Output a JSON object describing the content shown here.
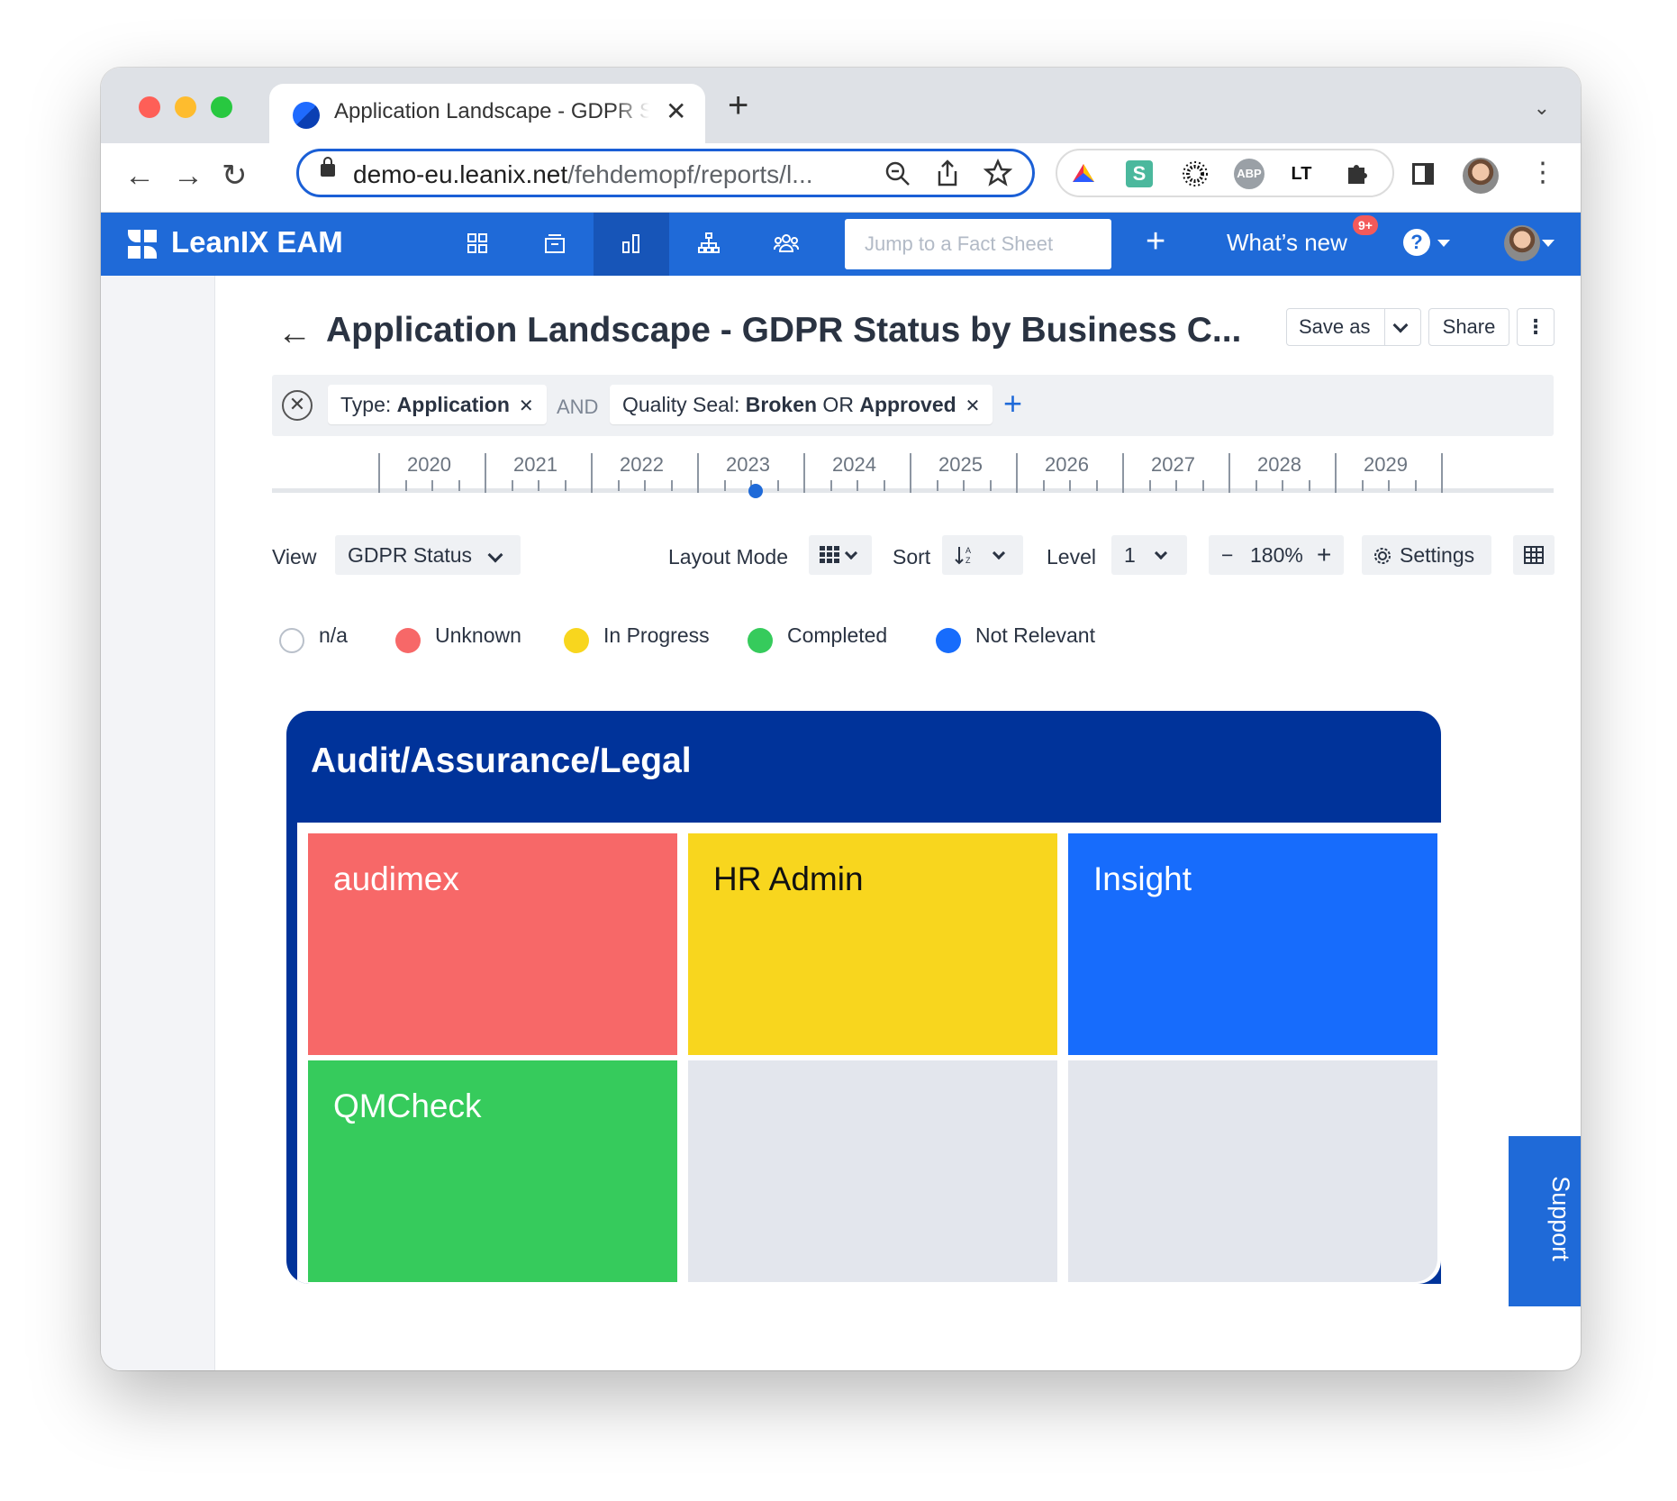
{
  "browser": {
    "tab_title": "Application Landscape - GDPR Status by Business Capability",
    "tab_close": "✕",
    "new_tab": "+",
    "url_host": "demo-eu.leanix.net",
    "url_path": "/fehdemopf/reports/l...",
    "extensions": [
      "zoom-icon",
      "share-icon",
      "star-icon",
      "ext-a",
      "ext-s",
      "ext-sun",
      "ext-abp",
      "ext-lt",
      "puzzle-icon"
    ],
    "ext_labels": {
      "s": "S",
      "abp": "ABP",
      "lt": "LT"
    }
  },
  "app": {
    "logo": "LeanIX EAM",
    "search_placeholder": "Jump to a Fact Sheet",
    "add": "+",
    "whats_new": "What’s new",
    "badge": "9+",
    "help": "?",
    "brand_color": "#1f6ad8"
  },
  "page": {
    "title": "Application Landscape - GDPR Status by Business C...",
    "save_as": "Save as",
    "share": "Share",
    "more": "⋮",
    "filters": {
      "chip1_prefix": "Type: ",
      "chip1_value": "Application",
      "and": "AND",
      "chip2_prefix": "Quality Seal: ",
      "chip2_value1": "Broken",
      "chip2_or": " OR ",
      "chip2_value2": "Approved",
      "remove": "✕",
      "add": "+"
    },
    "timeline": {
      "years": [
        "2020",
        "2021",
        "2022",
        "2023",
        "2024",
        "2025",
        "2026",
        "2027",
        "2028",
        "2029"
      ],
      "selected": "2023"
    },
    "controls": {
      "view_label": "View",
      "view_value": "GDPR Status",
      "layout_label": "Layout Mode",
      "sort_label": "Sort",
      "level_label": "Level",
      "level_value": "1",
      "zoom_minus": "−",
      "zoom_value": "180%",
      "zoom_plus": "+",
      "settings": "Settings"
    },
    "legend": [
      {
        "label": "n/a",
        "color": "#ffffff"
      },
      {
        "label": "Unknown",
        "color": "#f76868"
      },
      {
        "label": "In Progress",
        "color": "#f8d61e"
      },
      {
        "label": "Completed",
        "color": "#36cb5c"
      },
      {
        "label": "Not Relevant",
        "color": "#176cfc"
      }
    ],
    "landscape": {
      "group": "Audit/Assurance/Legal",
      "group_color": "#00339a",
      "cells": [
        {
          "label": "audimex",
          "color": "#f76868",
          "text_color": "#ffffff"
        },
        {
          "label": "HR Admin",
          "color": "#f8d61e",
          "text_color": "#111111"
        },
        {
          "label": "Insight",
          "color": "#176cfc",
          "text_color": "#ffffff"
        },
        {
          "label": "QMCheck",
          "color": "#36cb5c",
          "text_color": "#ffffff"
        },
        {
          "label": "",
          "color": "#e3e6ed",
          "text_color": "#111111"
        },
        {
          "label": "",
          "color": "#e3e6ed",
          "text_color": "#111111"
        }
      ]
    },
    "support": "Support"
  }
}
